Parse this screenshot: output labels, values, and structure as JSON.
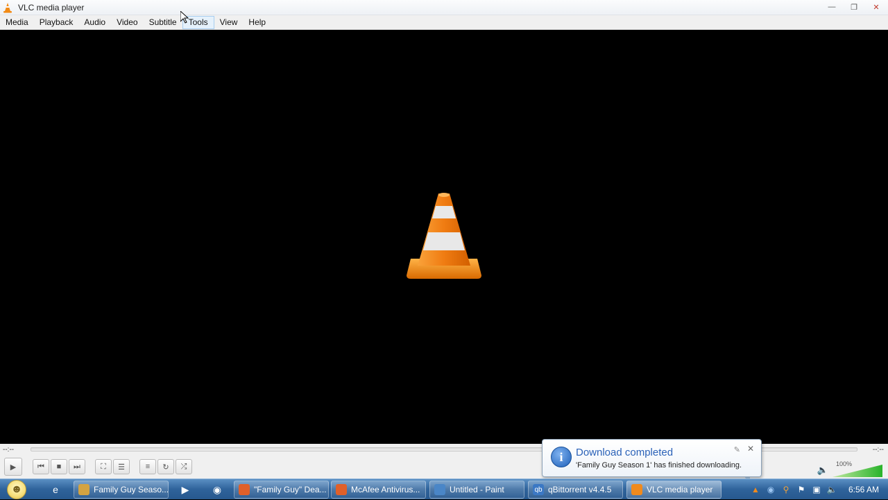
{
  "window": {
    "title": "VLC media player",
    "icon": "vlc-cone-icon"
  },
  "window_controls": [
    "minimize-icon",
    "maximize-icon",
    "close-icon"
  ],
  "menu": [
    "Media",
    "Playback",
    "Audio",
    "Video",
    "Subtitle",
    "Tools",
    "View",
    "Help"
  ],
  "hovered_menu": "Tools",
  "seek": {
    "elapsed": "--:--",
    "remaining": "--:--"
  },
  "controls": [
    "play-icon",
    "previous-icon",
    "stop-icon",
    "next-icon",
    "fullscreen-icon",
    "extended-settings-icon",
    "playlist-icon",
    "loop-icon",
    "shuffle-icon"
  ],
  "volume": {
    "level_text": "100%",
    "level": 1.0
  },
  "notification": {
    "title": "Download completed",
    "message": "'Family Guy Season 1' has finished downloading."
  },
  "taskbar": {
    "buttons": [
      {
        "label": "Family Guy Seaso...",
        "icon": "explorer-folder-icon",
        "color": "#d4a341"
      },
      {
        "label": "\"Family Guy\" Dea...",
        "icon": "firefox-icon",
        "color": "#e0602a"
      },
      {
        "label": "McAfee Antivirus...",
        "icon": "firefox-icon",
        "color": "#e0602a"
      },
      {
        "label": "Untitled - Paint",
        "icon": "paint-icon",
        "color": "#4a86c7"
      },
      {
        "label": "qBittorrent v4.4.5",
        "icon": "qbittorrent-icon",
        "color": "#3b78c4"
      },
      {
        "label": "VLC media player",
        "icon": "vlc-cone-icon",
        "color": "#f08a1d"
      }
    ],
    "clock": "6:56 AM"
  }
}
